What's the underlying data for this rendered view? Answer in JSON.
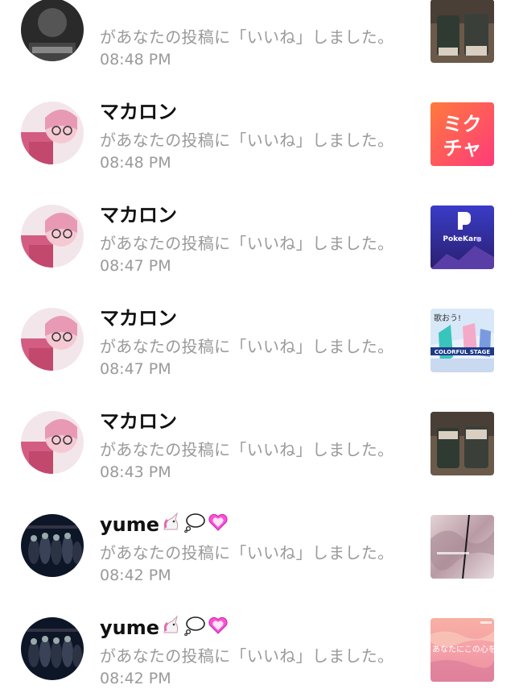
{
  "notifications": [
    {
      "user": "",
      "message": "があなたの投稿に「いいね」しました。",
      "time": "08:48 PM",
      "avatar": "dark-portrait-avatar",
      "thumbnail": "coffee-cups-photo"
    },
    {
      "user": "マカロン",
      "message": "があなたの投稿に「いいね」しました。",
      "time": "08:48 PM",
      "avatar": "pink-anime-avatar",
      "thumbnail": "mixchannel-app-logo",
      "thumbnail_text": "ミクチャ"
    },
    {
      "user": "マカロン",
      "message": "があなたの投稿に「いいね」しました。",
      "time": "08:47 PM",
      "avatar": "pink-anime-avatar",
      "thumbnail": "pokekara-app-logo",
      "thumbnail_text": "PokeKara"
    },
    {
      "user": "マカロン",
      "message": "があなたの投稿に「いいね」しました。",
      "time": "08:47 PM",
      "avatar": "pink-anime-avatar",
      "thumbnail": "colorful-stage-banner",
      "thumbnail_text": "歌おう!",
      "thumbnail_subtext": "COLORFUL STAGE"
    },
    {
      "user": "マカロン",
      "message": "があなたの投稿に「いいね」しました。",
      "time": "08:43 PM",
      "avatar": "pink-anime-avatar",
      "thumbnail": "coffee-cups-photo"
    },
    {
      "user": "yume",
      "message": "があなたの投稿に「いいね」しました。",
      "time": "08:42 PM",
      "avatar": "group-photo-avatar",
      "thumbnail": "blurred-pink-photo"
    },
    {
      "user": "yume",
      "message": "があなたの投稿に「いいね」しました。",
      "time": "08:42 PM",
      "avatar": "group-photo-avatar",
      "thumbnail": "sunset-sky-photo",
      "thumbnail_text": "あなたにこの心を"
    }
  ],
  "colors": {
    "name": "#111111",
    "secondary_text": "#9a9a9a",
    "background": "#ffffff"
  }
}
